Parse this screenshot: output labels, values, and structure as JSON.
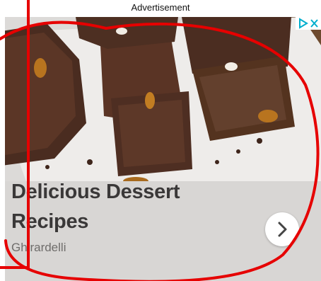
{
  "advertisement_label": "Advertisement",
  "ad": {
    "headline": "Delicious Dessert Recipes",
    "brand": "Ghirardelli",
    "image_subject": "chocolate brownies with caramel on parchment paper",
    "adchoices_icons": [
      "adchoices-play-icon",
      "close-icon"
    ],
    "next_icon": "chevron-right-icon"
  },
  "annotation": {
    "color": "#e60000"
  },
  "colors": {
    "adchoices_blue": "#00aecd",
    "headline": "#3a3838",
    "brand": "#6f6d6b"
  }
}
